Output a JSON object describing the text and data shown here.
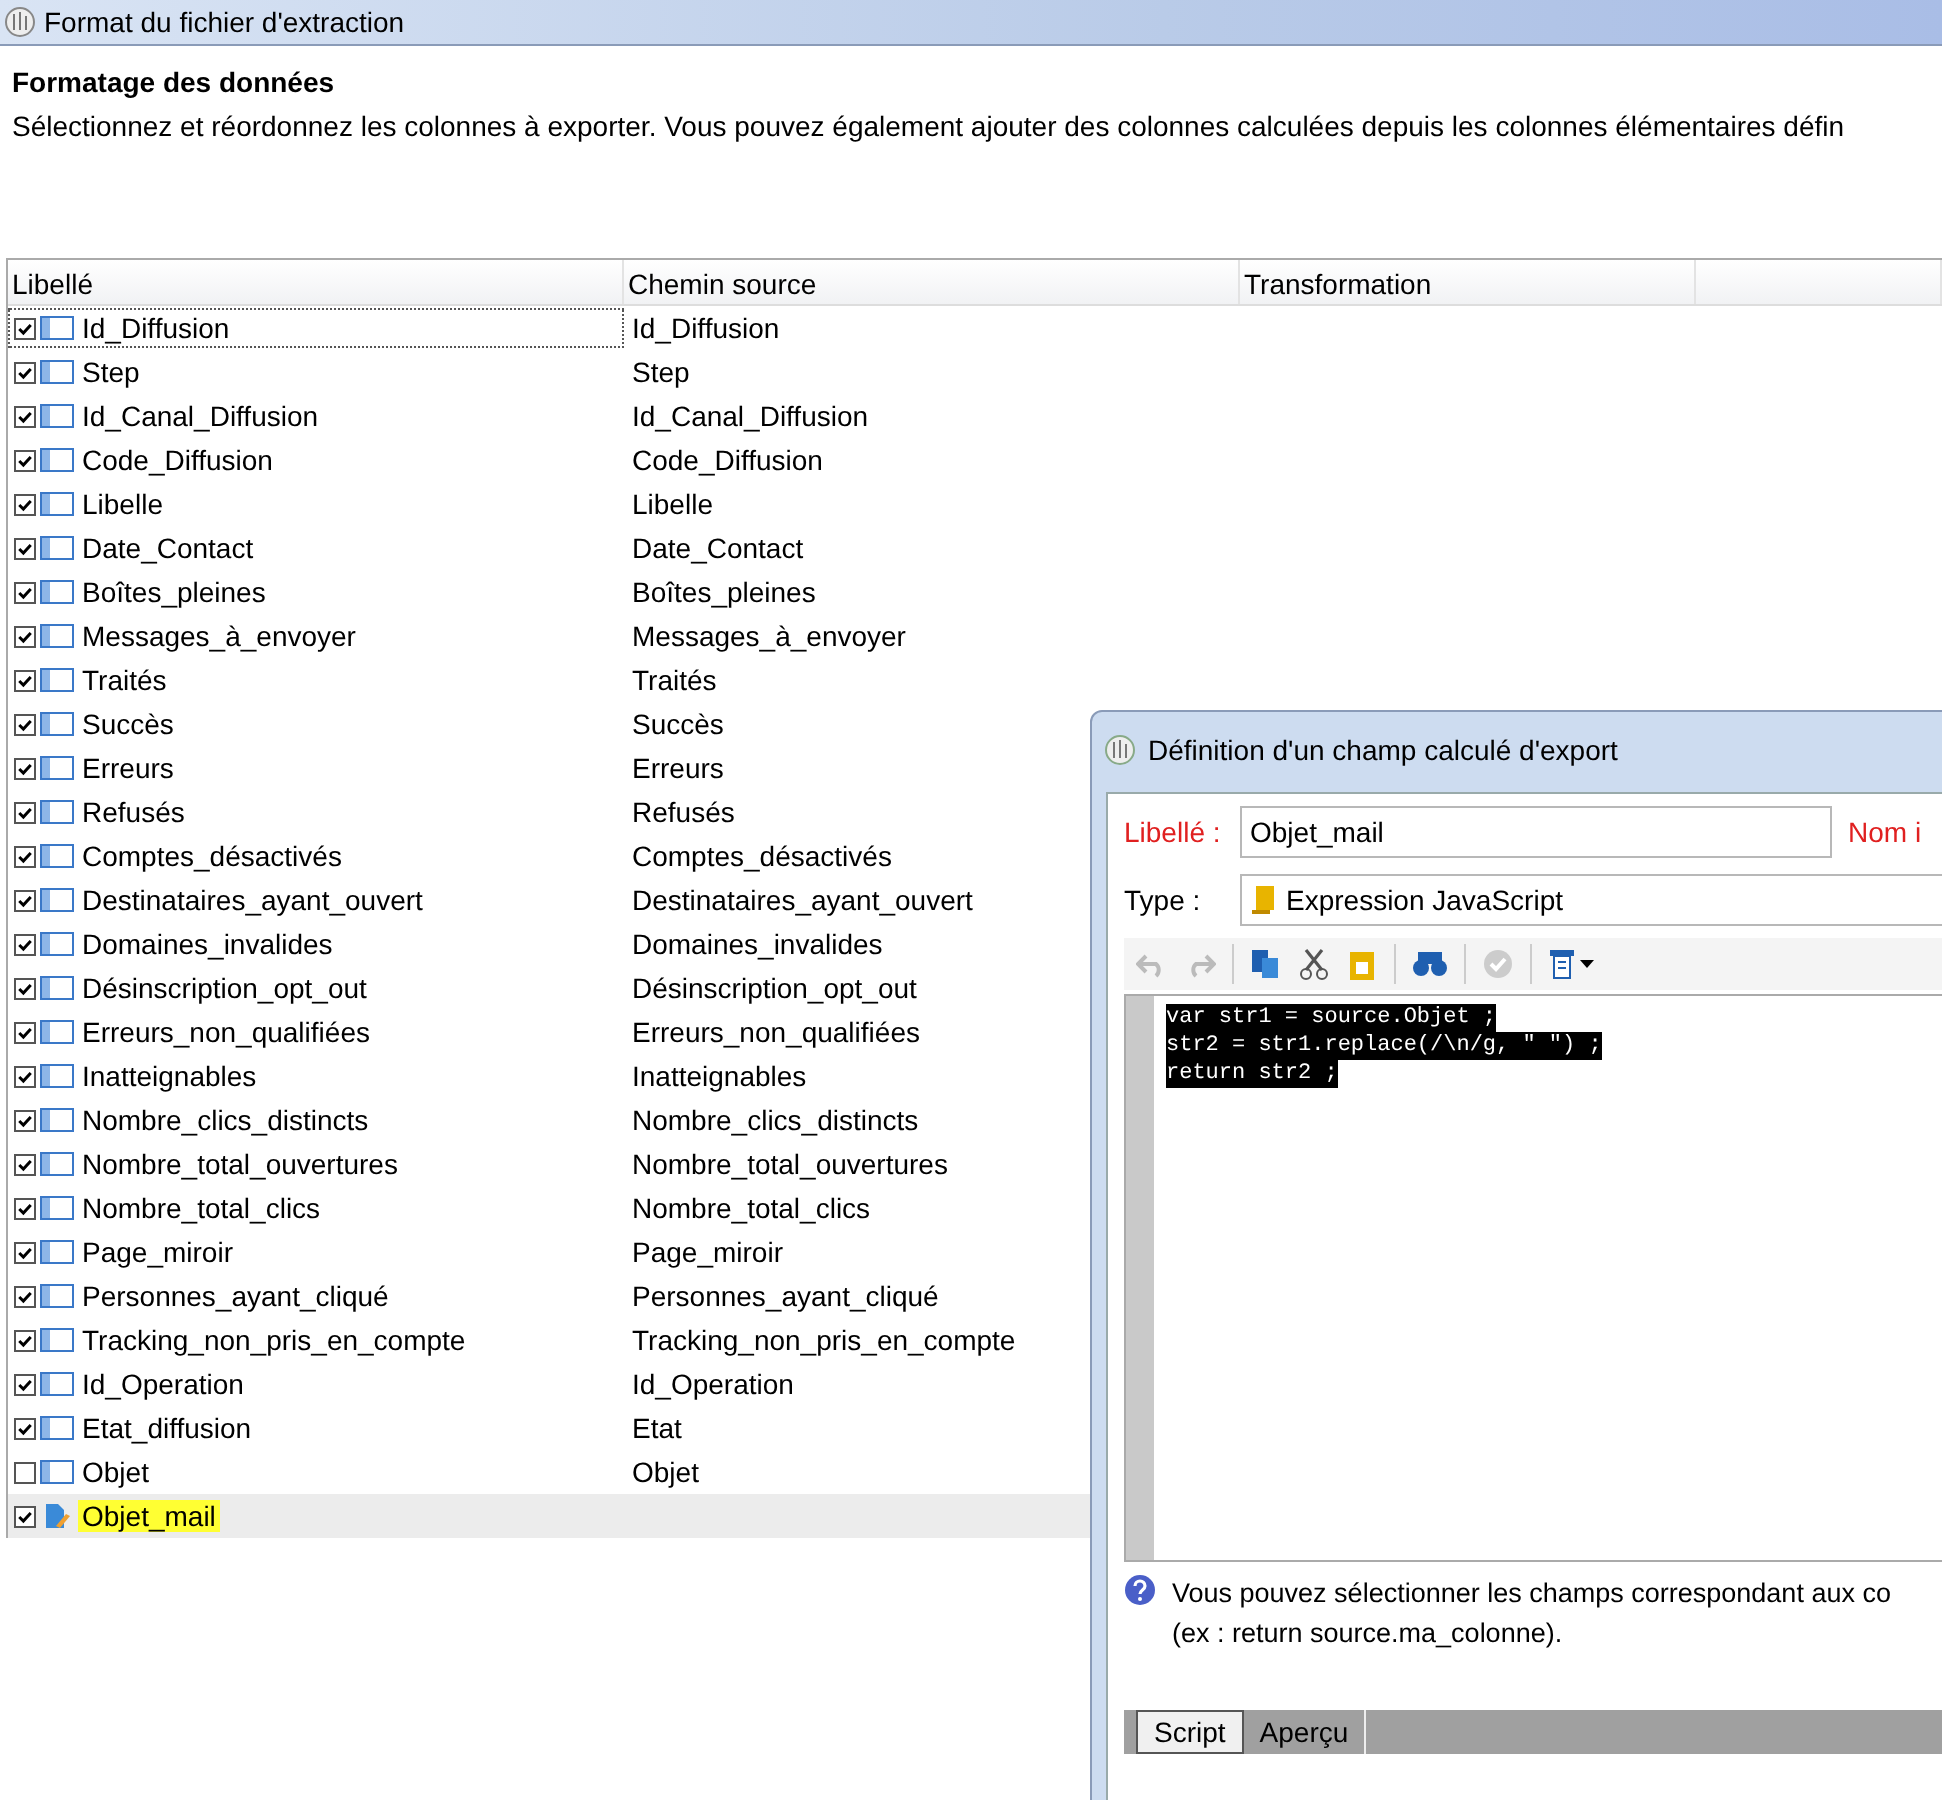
{
  "window": {
    "title": "Format du fichier d'extraction"
  },
  "section": {
    "heading": "Formatage des données",
    "description": "Sélectionnez et réordonnez les colonnes à exporter. Vous pouvez également ajouter des colonnes calculées depuis les colonnes élémentaires défin"
  },
  "table": {
    "columns": [
      "Libellé",
      "Chemin source",
      "Transformation"
    ],
    "rows": [
      {
        "kind": "column",
        "label": "Id_Diffusion",
        "source": "Id_Diffusion",
        "checked": true,
        "selected": false,
        "focused": true,
        "highlighted": false
      },
      {
        "kind": "column",
        "label": "Step",
        "source": "Step",
        "checked": true,
        "selected": false,
        "focused": false,
        "highlighted": false
      },
      {
        "kind": "column",
        "label": "Id_Canal_Diffusion",
        "source": "Id_Canal_Diffusion",
        "checked": true,
        "selected": false,
        "focused": false,
        "highlighted": false
      },
      {
        "kind": "column",
        "label": "Code_Diffusion",
        "source": "Code_Diffusion",
        "checked": true,
        "selected": false,
        "focused": false,
        "highlighted": false
      },
      {
        "kind": "column",
        "label": "Libelle",
        "source": "Libelle",
        "checked": true,
        "selected": false,
        "focused": false,
        "highlighted": false
      },
      {
        "kind": "column",
        "label": "Date_Contact",
        "source": "Date_Contact",
        "checked": true,
        "selected": false,
        "focused": false,
        "highlighted": false
      },
      {
        "kind": "column",
        "label": "Boîtes_pleines",
        "source": "Boîtes_pleines",
        "checked": true,
        "selected": false,
        "focused": false,
        "highlighted": false
      },
      {
        "kind": "column",
        "label": "Messages_à_envoyer",
        "source": "Messages_à_envoyer",
        "checked": true,
        "selected": false,
        "focused": false,
        "highlighted": false
      },
      {
        "kind": "column",
        "label": "Traités",
        "source": "Traités",
        "checked": true,
        "selected": false,
        "focused": false,
        "highlighted": false
      },
      {
        "kind": "column",
        "label": "Succès",
        "source": "Succès",
        "checked": true,
        "selected": false,
        "focused": false,
        "highlighted": false
      },
      {
        "kind": "column",
        "label": "Erreurs",
        "source": "Erreurs",
        "checked": true,
        "selected": false,
        "focused": false,
        "highlighted": false
      },
      {
        "kind": "column",
        "label": "Refusés",
        "source": "Refusés",
        "checked": true,
        "selected": false,
        "focused": false,
        "highlighted": false
      },
      {
        "kind": "column",
        "label": "Comptes_désactivés",
        "source": "Comptes_désactivés",
        "checked": true,
        "selected": false,
        "focused": false,
        "highlighted": false
      },
      {
        "kind": "column",
        "label": "Destinataires_ayant_ouvert",
        "source": "Destinataires_ayant_ouvert",
        "checked": true,
        "selected": false,
        "focused": false,
        "highlighted": false
      },
      {
        "kind": "column",
        "label": "Domaines_invalides",
        "source": "Domaines_invalides",
        "checked": true,
        "selected": false,
        "focused": false,
        "highlighted": false
      },
      {
        "kind": "column",
        "label": "Désinscription_opt_out",
        "source": "Désinscription_opt_out",
        "checked": true,
        "selected": false,
        "focused": false,
        "highlighted": false
      },
      {
        "kind": "column",
        "label": "Erreurs_non_qualifiées",
        "source": "Erreurs_non_qualifiées",
        "checked": true,
        "selected": false,
        "focused": false,
        "highlighted": false
      },
      {
        "kind": "column",
        "label": "Inatteignables",
        "source": "Inatteignables",
        "checked": true,
        "selected": false,
        "focused": false,
        "highlighted": false
      },
      {
        "kind": "column",
        "label": "Nombre_clics_distincts",
        "source": "Nombre_clics_distincts",
        "checked": true,
        "selected": false,
        "focused": false,
        "highlighted": false
      },
      {
        "kind": "column",
        "label": "Nombre_total_ouvertures",
        "source": "Nombre_total_ouvertures",
        "checked": true,
        "selected": false,
        "focused": false,
        "highlighted": false
      },
      {
        "kind": "column",
        "label": "Nombre_total_clics",
        "source": "Nombre_total_clics",
        "checked": true,
        "selected": false,
        "focused": false,
        "highlighted": false
      },
      {
        "kind": "column",
        "label": "Page_miroir",
        "source": "Page_miroir",
        "checked": true,
        "selected": false,
        "focused": false,
        "highlighted": false
      },
      {
        "kind": "column",
        "label": "Personnes_ayant_cliqué",
        "source": "Personnes_ayant_cliqué",
        "checked": true,
        "selected": false,
        "focused": false,
        "highlighted": false
      },
      {
        "kind": "column",
        "label": "Tracking_non_pris_en_compte",
        "source": "Tracking_non_pris_en_compte",
        "checked": true,
        "selected": false,
        "focused": false,
        "highlighted": false
      },
      {
        "kind": "column",
        "label": "Id_Operation",
        "source": "Id_Operation",
        "checked": true,
        "selected": false,
        "focused": false,
        "highlighted": false
      },
      {
        "kind": "column",
        "label": "Etat_diffusion",
        "source": "Etat",
        "checked": true,
        "selected": false,
        "focused": false,
        "highlighted": false
      },
      {
        "kind": "column",
        "label": "Objet",
        "source": "Objet",
        "checked": false,
        "selected": false,
        "focused": false,
        "highlighted": false
      },
      {
        "kind": "computed",
        "label": "Objet_mail",
        "checked": true,
        "selected": true,
        "focused": false,
        "highlighted": true
      }
    ]
  },
  "dialog": {
    "title": "Définition d'un champ calculé d'export",
    "label_field": {
      "label": "Libellé :",
      "value": "Objet_mail"
    },
    "name_label": "Nom i",
    "type_field": {
      "label": "Type :",
      "value": "Expression JavaScript"
    },
    "code_lines": [
      "var str1 = source.Objet ;",
      "str2 = str1.replace(/\\n/g, \" \") ;",
      "return str2 ;"
    ],
    "help_lines": [
      "Vous pouvez sélectionner les champs correspondant aux co",
      "(ex : return source.ma_colonne)."
    ],
    "tabs": [
      {
        "label": "Script",
        "selected": true
      },
      {
        "label": "Aperçu",
        "selected": false
      }
    ]
  }
}
